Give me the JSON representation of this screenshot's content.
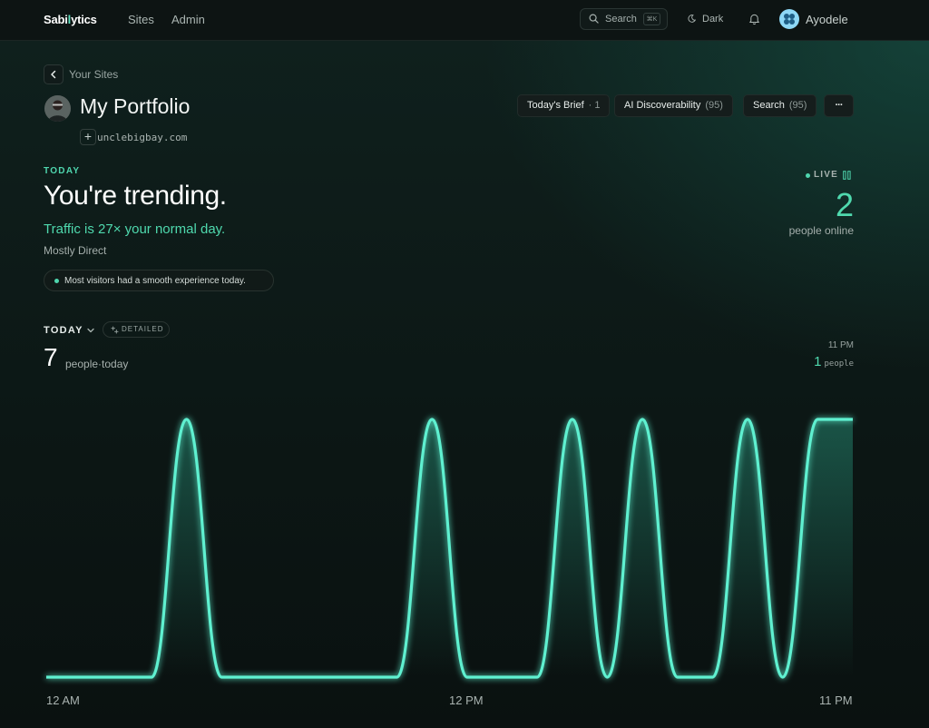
{
  "nav": {
    "brand_prefix": "Sabi",
    "brand_highlight": "l",
    "brand_suffix": "ytics",
    "links": [
      "Sites",
      "Admin"
    ],
    "search_label": "Search",
    "search_shortcut": "⌘K",
    "theme_label": "Dark",
    "user_name": "Ayodele"
  },
  "site": {
    "back_label": "Your Sites",
    "title": "My Portfolio",
    "domain": "unclebigbay.com",
    "add_icon": "+"
  },
  "actions": [
    {
      "label": "Today's Brief",
      "meta": "· 1"
    },
    {
      "label": "AI Discoverability",
      "meta": "(95)"
    },
    {
      "label": "Search",
      "meta": "(95)"
    },
    {
      "label": "···",
      "meta": ""
    }
  ],
  "insight": {
    "eyebrow": "TODAY",
    "headline": "You're trending.",
    "subhead": "Traffic is 27× your normal day.",
    "source": "Mostly Direct",
    "note": "Most visitors had a smooth experience today."
  },
  "live": {
    "label": "LIVE",
    "count": "2",
    "caption": "people online"
  },
  "range": {
    "label": "TODAY",
    "mode": "DETAILED",
    "visitors": "7",
    "visitors_caption": "people·today"
  },
  "hover": {
    "time": "11 PM",
    "value": "1",
    "unit": "people"
  },
  "colors": {
    "accent": "#4fd9ae",
    "line": "#5ef0d0",
    "background": "#0b1211"
  },
  "icons": [
    "search-icon",
    "moon-icon",
    "bell-icon",
    "chevron-left-icon",
    "chevron-down-icon",
    "pause-icon",
    "sparkle-icon"
  ],
  "chart_data": {
    "type": "area",
    "x": [
      "12 AM",
      "1 AM",
      "2 AM",
      "3 AM",
      "4 AM",
      "5 AM",
      "6 AM",
      "7 AM",
      "8 AM",
      "9 AM",
      "10 AM",
      "11 AM",
      "12 PM",
      "1 PM",
      "2 PM",
      "3 PM",
      "4 PM",
      "5 PM",
      "6 PM",
      "7 PM",
      "8 PM",
      "9 PM",
      "10 PM",
      "11 PM"
    ],
    "values": [
      0,
      0,
      0,
      0,
      1,
      0,
      0,
      0,
      0,
      0,
      0,
      1,
      0,
      0,
      0,
      1,
      0,
      1,
      0,
      0,
      1,
      0,
      1,
      1
    ],
    "x_tick_labels": [
      "12 AM",
      "12 PM",
      "11 PM"
    ],
    "ylim": [
      0,
      1
    ],
    "grid": false,
    "legend": "none"
  }
}
